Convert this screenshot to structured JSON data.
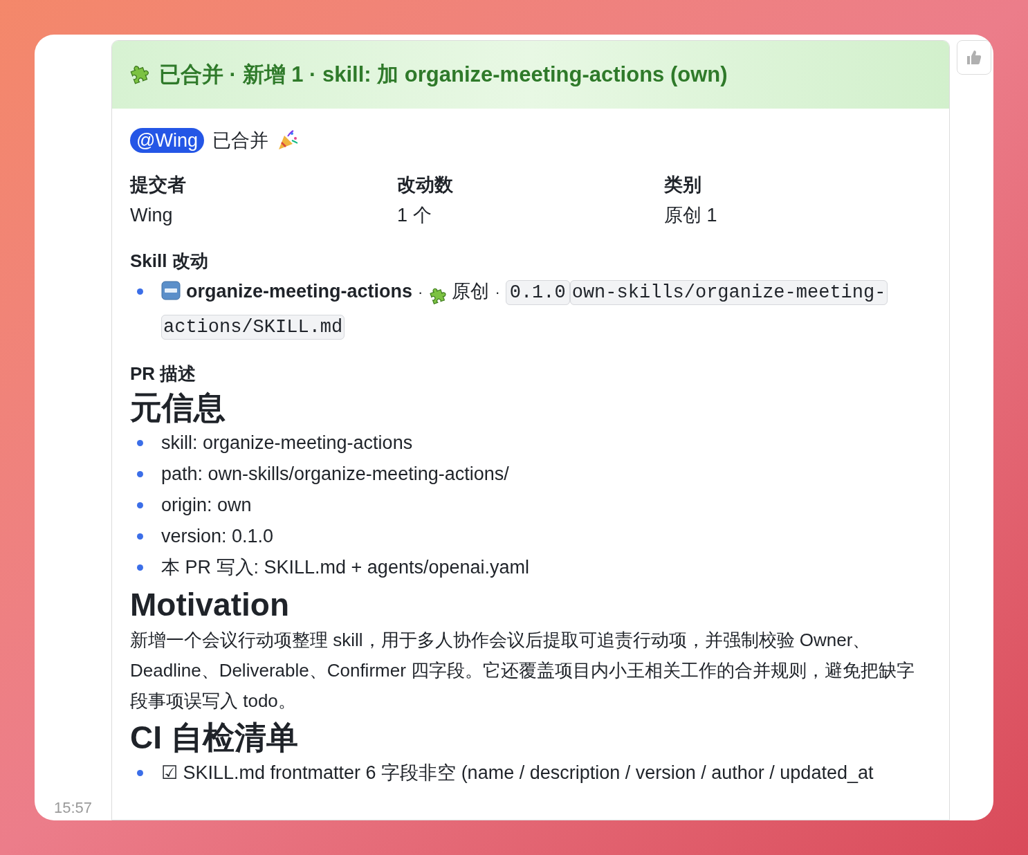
{
  "header": {
    "title": "已合并 · 新增 1 · skill: 加 organize-meeting-actions (own)"
  },
  "mention": "@Wing",
  "merged_text": "已合并",
  "fields": [
    {
      "label": "提交者",
      "value": "Wing"
    },
    {
      "label": "改动数",
      "value": "1 个"
    },
    {
      "label": "类别",
      "value": "原创 1"
    }
  ],
  "skill_changes": {
    "heading": "Skill 改动",
    "items": [
      {
        "name": "organize-meeting-actions",
        "separator": "·",
        "origin": "原创",
        "separator_2": "·",
        "version": "0.1.0",
        "path": "own-skills/organize-meeting-actions/SKILL.md"
      }
    ]
  },
  "pr_description": {
    "heading": "PR 描述",
    "blocks": [
      {
        "kind": "heading",
        "text": "元信息"
      },
      {
        "kind": "list",
        "items": [
          "skill: organize-meeting-actions",
          "path: own-skills/organize-meeting-actions/",
          "origin: own",
          "version: 0.1.0",
          "本 PR 写入: SKILL.md + agents/openai.yaml"
        ]
      },
      {
        "kind": "heading",
        "text": "Motivation"
      },
      {
        "kind": "paragraph",
        "text": "新增一个会议行动项整理 skill，用于多人协作会议后提取可追责行动项，并强制校验 Owner、Deadline、Deliverable、Confirmer 四字段。它还覆盖项目内小王相关工作的合并规则，避免把缺字段事项误写入 todo。"
      },
      {
        "kind": "heading",
        "text": "CI 自检清单"
      },
      {
        "kind": "list",
        "items": [
          "☑ SKILL.md frontmatter 6 字段非空 (name / description / version / author / updated_at"
        ]
      }
    ]
  },
  "timestamp": "15:57"
}
